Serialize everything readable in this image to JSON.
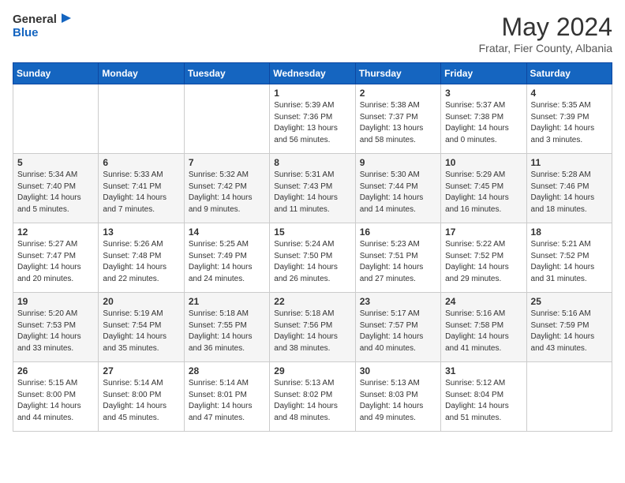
{
  "header": {
    "logo_line1": "General",
    "logo_line2": "Blue",
    "month_title": "May 2024",
    "subtitle": "Fratar, Fier County, Albania"
  },
  "weekdays": [
    "Sunday",
    "Monday",
    "Tuesday",
    "Wednesday",
    "Thursday",
    "Friday",
    "Saturday"
  ],
  "weeks": [
    [
      {
        "day": "",
        "info": ""
      },
      {
        "day": "",
        "info": ""
      },
      {
        "day": "",
        "info": ""
      },
      {
        "day": "1",
        "info": "Sunrise: 5:39 AM\nSunset: 7:36 PM\nDaylight: 13 hours\nand 56 minutes."
      },
      {
        "day": "2",
        "info": "Sunrise: 5:38 AM\nSunset: 7:37 PM\nDaylight: 13 hours\nand 58 minutes."
      },
      {
        "day": "3",
        "info": "Sunrise: 5:37 AM\nSunset: 7:38 PM\nDaylight: 14 hours\nand 0 minutes."
      },
      {
        "day": "4",
        "info": "Sunrise: 5:35 AM\nSunset: 7:39 PM\nDaylight: 14 hours\nand 3 minutes."
      }
    ],
    [
      {
        "day": "5",
        "info": "Sunrise: 5:34 AM\nSunset: 7:40 PM\nDaylight: 14 hours\nand 5 minutes."
      },
      {
        "day": "6",
        "info": "Sunrise: 5:33 AM\nSunset: 7:41 PM\nDaylight: 14 hours\nand 7 minutes."
      },
      {
        "day": "7",
        "info": "Sunrise: 5:32 AM\nSunset: 7:42 PM\nDaylight: 14 hours\nand 9 minutes."
      },
      {
        "day": "8",
        "info": "Sunrise: 5:31 AM\nSunset: 7:43 PM\nDaylight: 14 hours\nand 11 minutes."
      },
      {
        "day": "9",
        "info": "Sunrise: 5:30 AM\nSunset: 7:44 PM\nDaylight: 14 hours\nand 14 minutes."
      },
      {
        "day": "10",
        "info": "Sunrise: 5:29 AM\nSunset: 7:45 PM\nDaylight: 14 hours\nand 16 minutes."
      },
      {
        "day": "11",
        "info": "Sunrise: 5:28 AM\nSunset: 7:46 PM\nDaylight: 14 hours\nand 18 minutes."
      }
    ],
    [
      {
        "day": "12",
        "info": "Sunrise: 5:27 AM\nSunset: 7:47 PM\nDaylight: 14 hours\nand 20 minutes."
      },
      {
        "day": "13",
        "info": "Sunrise: 5:26 AM\nSunset: 7:48 PM\nDaylight: 14 hours\nand 22 minutes."
      },
      {
        "day": "14",
        "info": "Sunrise: 5:25 AM\nSunset: 7:49 PM\nDaylight: 14 hours\nand 24 minutes."
      },
      {
        "day": "15",
        "info": "Sunrise: 5:24 AM\nSunset: 7:50 PM\nDaylight: 14 hours\nand 26 minutes."
      },
      {
        "day": "16",
        "info": "Sunrise: 5:23 AM\nSunset: 7:51 PM\nDaylight: 14 hours\nand 27 minutes."
      },
      {
        "day": "17",
        "info": "Sunrise: 5:22 AM\nSunset: 7:52 PM\nDaylight: 14 hours\nand 29 minutes."
      },
      {
        "day": "18",
        "info": "Sunrise: 5:21 AM\nSunset: 7:52 PM\nDaylight: 14 hours\nand 31 minutes."
      }
    ],
    [
      {
        "day": "19",
        "info": "Sunrise: 5:20 AM\nSunset: 7:53 PM\nDaylight: 14 hours\nand 33 minutes."
      },
      {
        "day": "20",
        "info": "Sunrise: 5:19 AM\nSunset: 7:54 PM\nDaylight: 14 hours\nand 35 minutes."
      },
      {
        "day": "21",
        "info": "Sunrise: 5:18 AM\nSunset: 7:55 PM\nDaylight: 14 hours\nand 36 minutes."
      },
      {
        "day": "22",
        "info": "Sunrise: 5:18 AM\nSunset: 7:56 PM\nDaylight: 14 hours\nand 38 minutes."
      },
      {
        "day": "23",
        "info": "Sunrise: 5:17 AM\nSunset: 7:57 PM\nDaylight: 14 hours\nand 40 minutes."
      },
      {
        "day": "24",
        "info": "Sunrise: 5:16 AM\nSunset: 7:58 PM\nDaylight: 14 hours\nand 41 minutes."
      },
      {
        "day": "25",
        "info": "Sunrise: 5:16 AM\nSunset: 7:59 PM\nDaylight: 14 hours\nand 43 minutes."
      }
    ],
    [
      {
        "day": "26",
        "info": "Sunrise: 5:15 AM\nSunset: 8:00 PM\nDaylight: 14 hours\nand 44 minutes."
      },
      {
        "day": "27",
        "info": "Sunrise: 5:14 AM\nSunset: 8:00 PM\nDaylight: 14 hours\nand 45 minutes."
      },
      {
        "day": "28",
        "info": "Sunrise: 5:14 AM\nSunset: 8:01 PM\nDaylight: 14 hours\nand 47 minutes."
      },
      {
        "day": "29",
        "info": "Sunrise: 5:13 AM\nSunset: 8:02 PM\nDaylight: 14 hours\nand 48 minutes."
      },
      {
        "day": "30",
        "info": "Sunrise: 5:13 AM\nSunset: 8:03 PM\nDaylight: 14 hours\nand 49 minutes."
      },
      {
        "day": "31",
        "info": "Sunrise: 5:12 AM\nSunset: 8:04 PM\nDaylight: 14 hours\nand 51 minutes."
      },
      {
        "day": "",
        "info": ""
      }
    ]
  ]
}
